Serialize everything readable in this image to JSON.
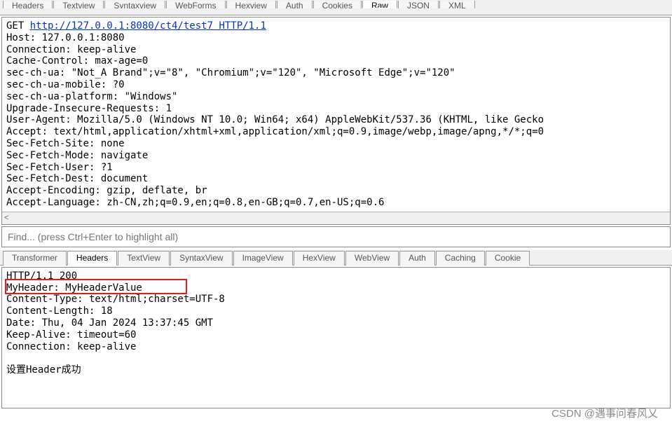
{
  "request_tabs": [
    "Headers",
    "Textview",
    "Syntaxview",
    "WebForms",
    "Hexview",
    "Auth",
    "Cookies",
    "Raw",
    "JSON",
    "XML"
  ],
  "request_active_tab": 7,
  "request_method": "GET ",
  "request_url": "http://127.0.0.1:8080/ct4/test7 HTTP/1.1",
  "request_headers": "Host: 127.0.0.1:8080\nConnection: keep-alive\nCache-Control: max-age=0\nsec-ch-ua: \"Not_A Brand\";v=\"8\", \"Chromium\";v=\"120\", \"Microsoft Edge\";v=\"120\"\nsec-ch-ua-mobile: ?0\nsec-ch-ua-platform: \"Windows\"\nUpgrade-Insecure-Requests: 1\nUser-Agent: Mozilla/5.0 (Windows NT 10.0; Win64; x64) AppleWebKit/537.36 (KHTML, like Gecko\nAccept: text/html,application/xhtml+xml,application/xml;q=0.9,image/webp,image/apng,*/*;q=0\nSec-Fetch-Site: none\nSec-Fetch-Mode: navigate\nSec-Fetch-User: ?1\nSec-Fetch-Dest: document\nAccept-Encoding: gzip, deflate, br\nAccept-Language: zh-CN,zh;q=0.9,en;q=0.8,en-GB;q=0.7,en-US;q=0.6",
  "scroll_hint": "<",
  "find_placeholder": "Find... (press Ctrl+Enter to highlight all)",
  "response_tabs": [
    "Transformer",
    "Headers",
    "TextView",
    "SyntaxView",
    "ImageView",
    "HexView",
    "WebView",
    "Auth",
    "Caching",
    "Cookie"
  ],
  "response_active_tab": 1,
  "response_body": "HTTP/1.1 200\nMyHeader: MyHeaderValue\nContent-Type: text/html;charset=UTF-8\nContent-Length: 18\nDate: Thu, 04 Jan 2024 13:37:45 GMT\nKeep-Alive: timeout=60\nConnection: keep-alive\n\n设置Header成功",
  "watermark": "CSDN @遇事问春风乂"
}
